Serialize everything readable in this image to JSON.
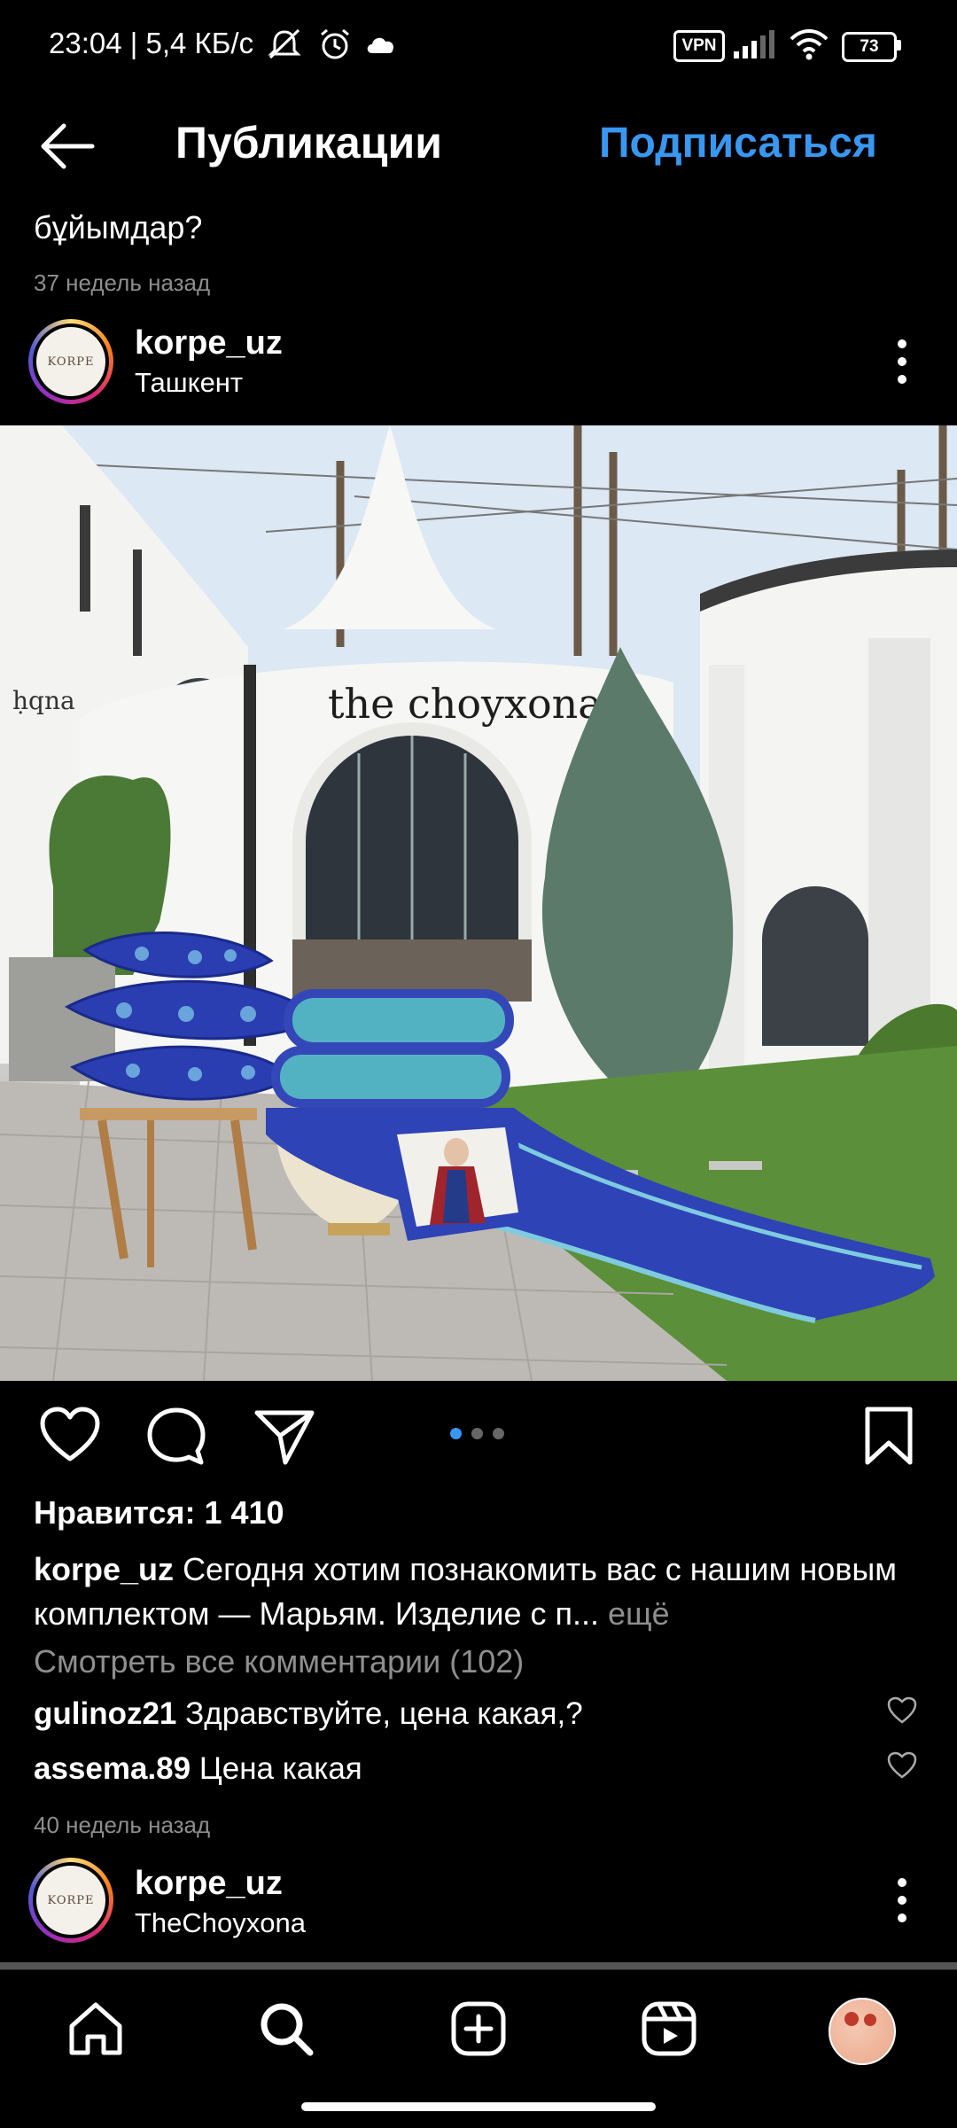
{
  "status_bar": {
    "time_speed": "23:04 | 5,4 КБ/с",
    "vpn": "VPN",
    "battery": "73"
  },
  "header": {
    "title": "Публикации",
    "follow_label": "Подписаться"
  },
  "previous_post": {
    "caption_tail": "бұйымдар?",
    "time_ago": "37 недель назад"
  },
  "post": {
    "username": "korpe_uz",
    "location": "Ташкент",
    "avatar_text": "KORPE",
    "sign_text": "the choyxona",
    "likes": "Нравится: 1 410",
    "caption_user": "korpe_uz",
    "caption_text": "Сегодня хотим познакомить вас с нашим новым комплектом — Марьям. Изделие с п...",
    "caption_more": "ещё",
    "view_all_comments": "Смотреть все комментарии (102)",
    "comments": [
      {
        "user": "gulinoz21",
        "text": "Здравствуйте, цена какая,?"
      },
      {
        "user": "assema.89",
        "text": "Цена какая"
      }
    ],
    "time_ago": "40 недель назад",
    "carousel": {
      "current": 1,
      "total": 3
    }
  },
  "next_post": {
    "username": "korpe_uz",
    "location": "TheChoyxona",
    "avatar_text": "KORPE"
  },
  "bottom_nav": {
    "items": [
      "home-icon",
      "search-icon",
      "create-icon",
      "reels-icon",
      "profile-avatar"
    ]
  },
  "colors": {
    "accent": "#3897f0",
    "secondary_text": "#8e8e8e"
  }
}
